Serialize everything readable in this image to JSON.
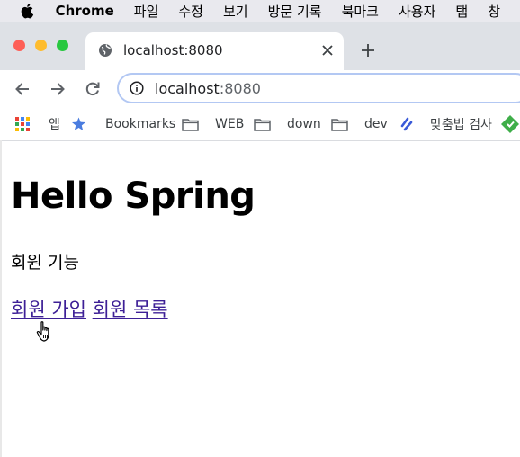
{
  "menubar": {
    "app_name": "Chrome",
    "items": [
      "파일",
      "수정",
      "보기",
      "방문 기록",
      "북마크",
      "사용자",
      "탭",
      "창"
    ]
  },
  "tab": {
    "title": "localhost:8080"
  },
  "address_bar": {
    "host": "localhost",
    "port": ":8080"
  },
  "bookmarks": {
    "apps": "앱",
    "items": [
      "Bookmarks",
      "WEB",
      "down",
      "dev",
      "맞춤법 검사"
    ]
  },
  "page": {
    "title": "Hello Spring",
    "section": "회원 기능",
    "links": [
      "회원 가입",
      "회원 목록"
    ]
  },
  "colors": {
    "link": "#3d1f96",
    "tab_strip": "#dee1e6",
    "menubar": "#e9e9ee"
  }
}
